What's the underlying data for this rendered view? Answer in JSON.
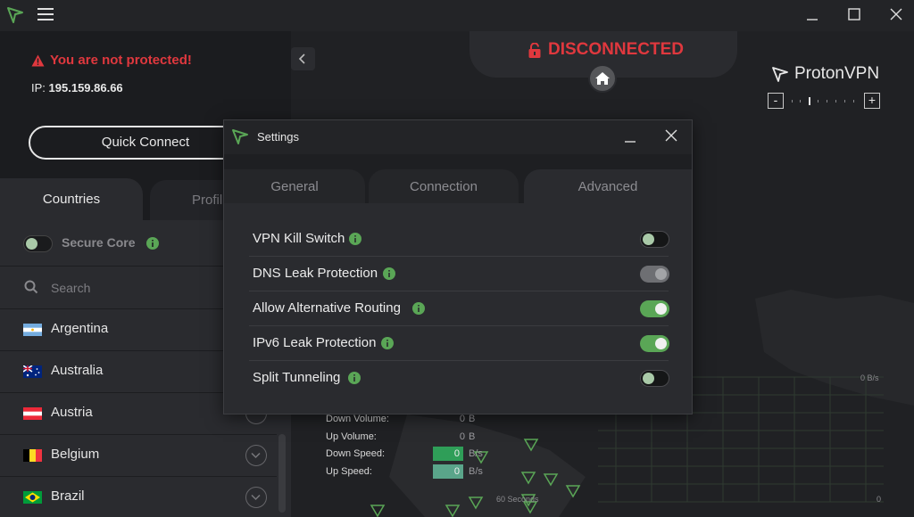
{
  "colors": {
    "accent_green": "#5aa656",
    "danger_red": "#e0383e",
    "background": "#1c1c1f"
  },
  "icons": {
    "app_logo": "protonvpn-triangle-icon",
    "menu": "hamburger-icon",
    "lock": "lock-open-icon",
    "home": "home-icon",
    "info": "info-icon",
    "search": "search-icon",
    "chevron": "chevron-down-icon"
  },
  "sidebar": {
    "warning": "You are not protected!",
    "ip_label": "IP:",
    "ip_value": "195.159.86.66",
    "quick_connect": "Quick Connect",
    "tabs": {
      "countries": "Countries",
      "profiles": "Profil"
    },
    "secure_core": "Secure Core",
    "search_placeholder": "Search",
    "countries": [
      "Argentina",
      "Australia",
      "Austria",
      "Belgium",
      "Brazil"
    ]
  },
  "status": {
    "label": "DISCONNECTED"
  },
  "brand": {
    "name": "ProtonVPN"
  },
  "zoom": {
    "minus": "-",
    "plus": "+"
  },
  "stats": {
    "down_volume_label": "Down Volume:",
    "down_volume_value": "0",
    "down_volume_unit": "B",
    "up_volume_label": "Up Volume:",
    "up_volume_value": "0",
    "up_volume_unit": "B",
    "down_speed_label": "Down Speed:",
    "down_speed_value": "0",
    "down_speed_unit": "B/s",
    "up_speed_label": "Up Speed:",
    "up_speed_value": "0",
    "up_speed_unit": "B/s",
    "axis_top_right": "0 B/s",
    "axis_bottom_mid": "60 Seconds",
    "axis_bottom_right": "0"
  },
  "settings": {
    "title": "Settings",
    "tabs": [
      "General",
      "Connection",
      "Advanced"
    ],
    "options": [
      {
        "label": "VPN Kill Switch",
        "state": "off"
      },
      {
        "label": "DNS Leak Protection",
        "state": "disabled-on"
      },
      {
        "label": "Allow Alternative Routing",
        "state": "on"
      },
      {
        "label": "IPv6 Leak Protection",
        "state": "on"
      },
      {
        "label": "Split Tunneling",
        "state": "off"
      }
    ]
  }
}
